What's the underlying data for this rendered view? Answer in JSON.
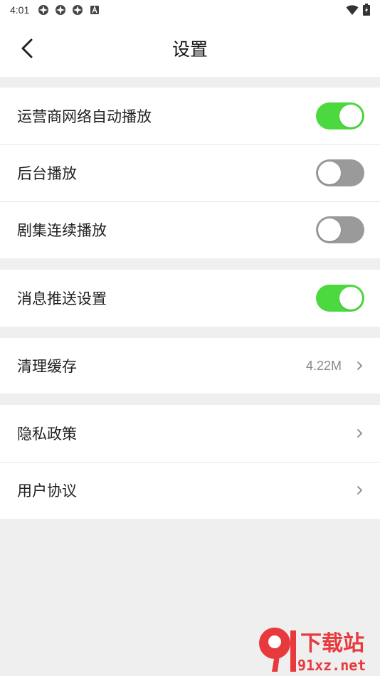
{
  "status_bar": {
    "time": "4:01",
    "icons": [
      "app-icon",
      "app-icon",
      "app-icon",
      "a-letter-icon"
    ],
    "right_icons": [
      "wifi-icon",
      "battery-icon"
    ]
  },
  "header": {
    "title": "设置",
    "back_icon": "chevron-left-icon"
  },
  "groups": [
    {
      "items": [
        {
          "label": "运营商网络自动播放",
          "type": "toggle",
          "on": true
        },
        {
          "label": "后台播放",
          "type": "toggle",
          "on": false
        },
        {
          "label": "剧集连续播放",
          "type": "toggle",
          "on": false
        }
      ]
    },
    {
      "items": [
        {
          "label": "消息推送设置",
          "type": "toggle",
          "on": true
        }
      ]
    },
    {
      "items": [
        {
          "label": "清理缓存",
          "type": "link",
          "value": "4.22M"
        }
      ]
    },
    {
      "items": [
        {
          "label": "隐私政策",
          "type": "link"
        },
        {
          "label": "用户协议",
          "type": "link"
        }
      ]
    }
  ],
  "colors": {
    "toggle_on": "#4cd93f",
    "toggle_off": "#9a9a9a",
    "background": "#efefef"
  },
  "watermark": {
    "text": "下载站",
    "url": "91xz.net"
  }
}
